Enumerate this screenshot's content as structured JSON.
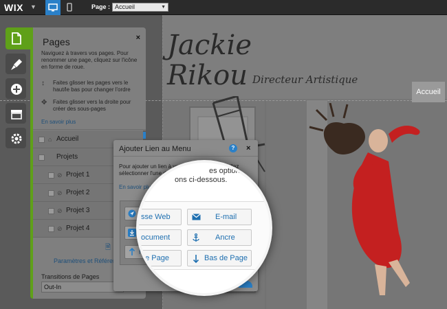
{
  "topbar": {
    "logo": "WIX",
    "page_label": "Page :",
    "page_selected": "Accueil"
  },
  "site": {
    "title_line1": "Jackie",
    "title_line2": "Rikou",
    "subtitle": "Directeur Artistique",
    "nav_item": "Accueil"
  },
  "pages_panel": {
    "title": "Pages",
    "close": "×",
    "description": "Naviguez à travers vos pages. Pour renommer une page, cliquez sur l'icône en forme de roue.",
    "tip1": "Faites glisser les pages vers le haut/le bas pour changer l'ordre",
    "tip2": "Faites glisser vers la droite pour créer des sous-pages",
    "learn_more": "En savoir plus",
    "pages": [
      {
        "label": "Accueil"
      },
      {
        "label": "Projets"
      },
      {
        "label": "Projet 1"
      },
      {
        "label": "Projet 2"
      },
      {
        "label": "Projet 3"
      },
      {
        "label": "Projet 4"
      }
    ],
    "settings_link": "Paramètres et Référen",
    "transitions_label": "Transitions de Pages",
    "transitions_value": "Out-In"
  },
  "dialog": {
    "title": "Ajouter Lien au Menu",
    "help": "?",
    "close": "×",
    "description": "Pour ajouter un lien à votre menu Pages, veuillez sélectionner l'une des options ci-dessous.",
    "learn_more": "En savoir plus",
    "buttons": [
      {
        "label": "Ad"
      },
      {
        "label": "H"
      }
    ]
  },
  "magnifier": {
    "desc_line1": "es options ci-",
    "desc_line2": "ons ci-dessous.",
    "buttons": [
      {
        "label": "sse Web"
      },
      {
        "label": "E-mail"
      },
      {
        "label": "ocument"
      },
      {
        "label": "Ancre"
      },
      {
        "label": "de Page"
      },
      {
        "label": "Bas de Page"
      }
    ]
  },
  "colors": {
    "accent_green": "#5fa019",
    "accent_blue": "#2a80c8",
    "link_blue": "#1e6fb0",
    "dress_red": "#c42020"
  }
}
